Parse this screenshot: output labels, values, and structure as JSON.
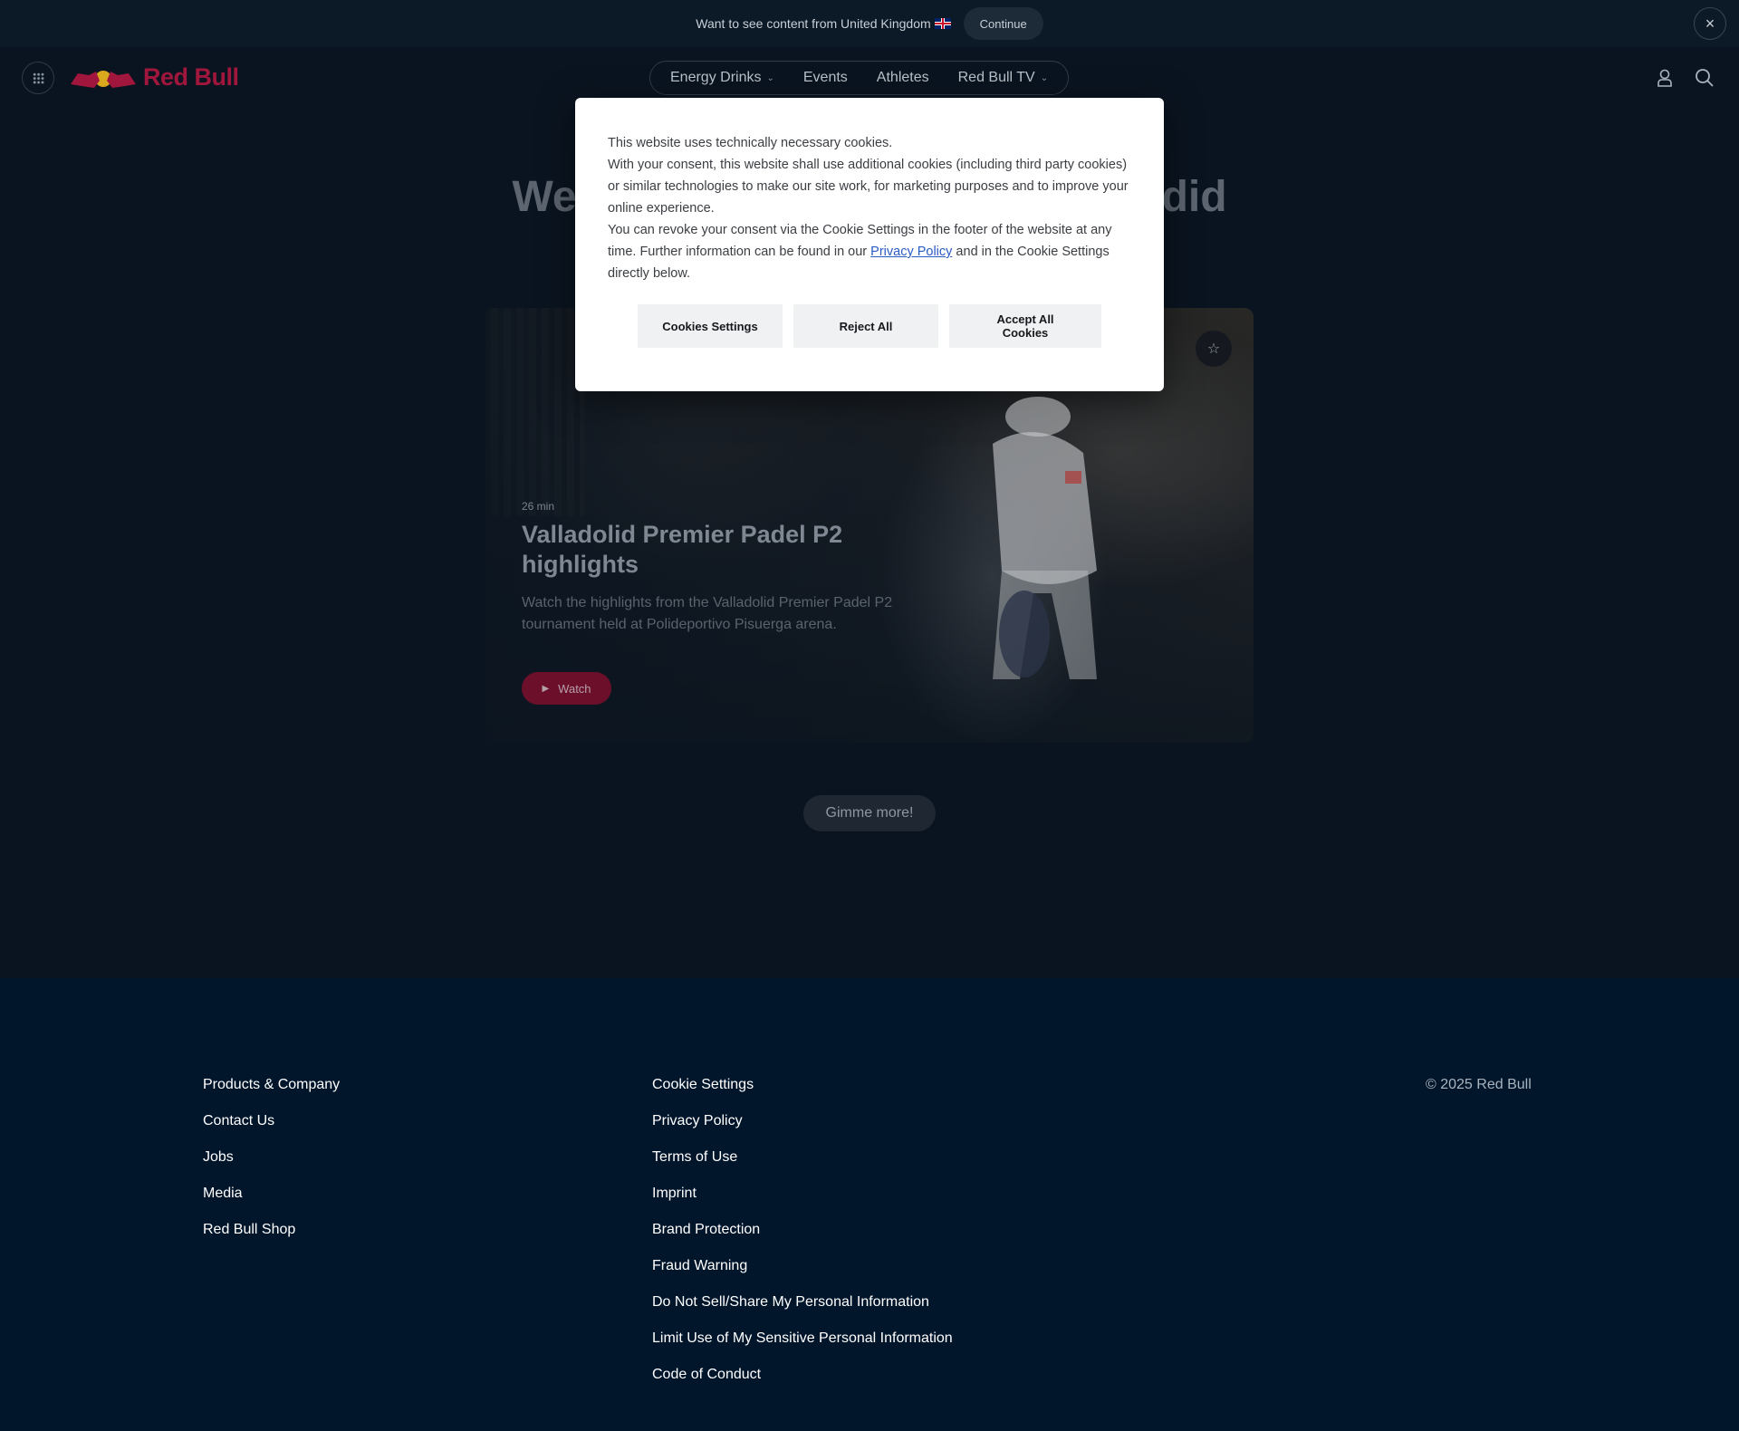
{
  "geo_banner": {
    "message": "Want to see content from United Kingdom",
    "continue_label": "Continue",
    "close_icon": "×"
  },
  "header": {
    "logo_text": "Red Bull",
    "nav": [
      {
        "label": "Energy Drinks",
        "has_dropdown": true
      },
      {
        "label": "Events",
        "has_dropdown": false
      },
      {
        "label": "Athletes",
        "has_dropdown": false
      },
      {
        "label": "Red Bull TV",
        "has_dropdown": true
      }
    ]
  },
  "page": {
    "heading_left": "We",
    "heading_right": "did"
  },
  "video_card": {
    "duration": "26 min",
    "title": "Valladolid Premier Padel P2 highlights",
    "description": "Watch the highlights from the Valladolid Premier Padel P2 tournament held at Polideportivo Pisuerga arena.",
    "watch_label": "Watch",
    "favorite_icon": "☆"
  },
  "more_button": "Gimme more!",
  "footer": {
    "col1": [
      "Products & Company",
      "Contact Us",
      "Jobs",
      "Media",
      "Red Bull Shop"
    ],
    "col2": [
      "Cookie Settings",
      "Privacy Policy",
      "Terms of Use",
      "Imprint",
      "Brand Protection",
      "Fraud Warning",
      "Do Not Sell/Share My Personal Information",
      "Limit Use of My Sensitive Personal Information",
      "Code of Conduct"
    ],
    "copyright": "© 2025 Red Bull"
  },
  "cookie_dialog": {
    "line1": "This website uses technically necessary cookies.",
    "line2": "With your consent, this website shall use additional cookies (including third party cookies) or similar technologies to make our site work, for marketing purposes and to improve your online experience.",
    "line3_pre": "You can revoke your consent via the Cookie Settings in the footer of the website at any time. Further information can be found in our ",
    "privacy_link": "Privacy Policy",
    "line3_post": " and in the Cookie Settings directly below.",
    "settings_label": "Cookies Settings",
    "reject_label": "Reject All",
    "accept_label": "Accept All Cookies"
  },
  "colors": {
    "brand_red": "#a0163c",
    "page_bg": "#0a1420",
    "footer_bg": "#01152b",
    "link_blue": "#2b5bc4"
  }
}
